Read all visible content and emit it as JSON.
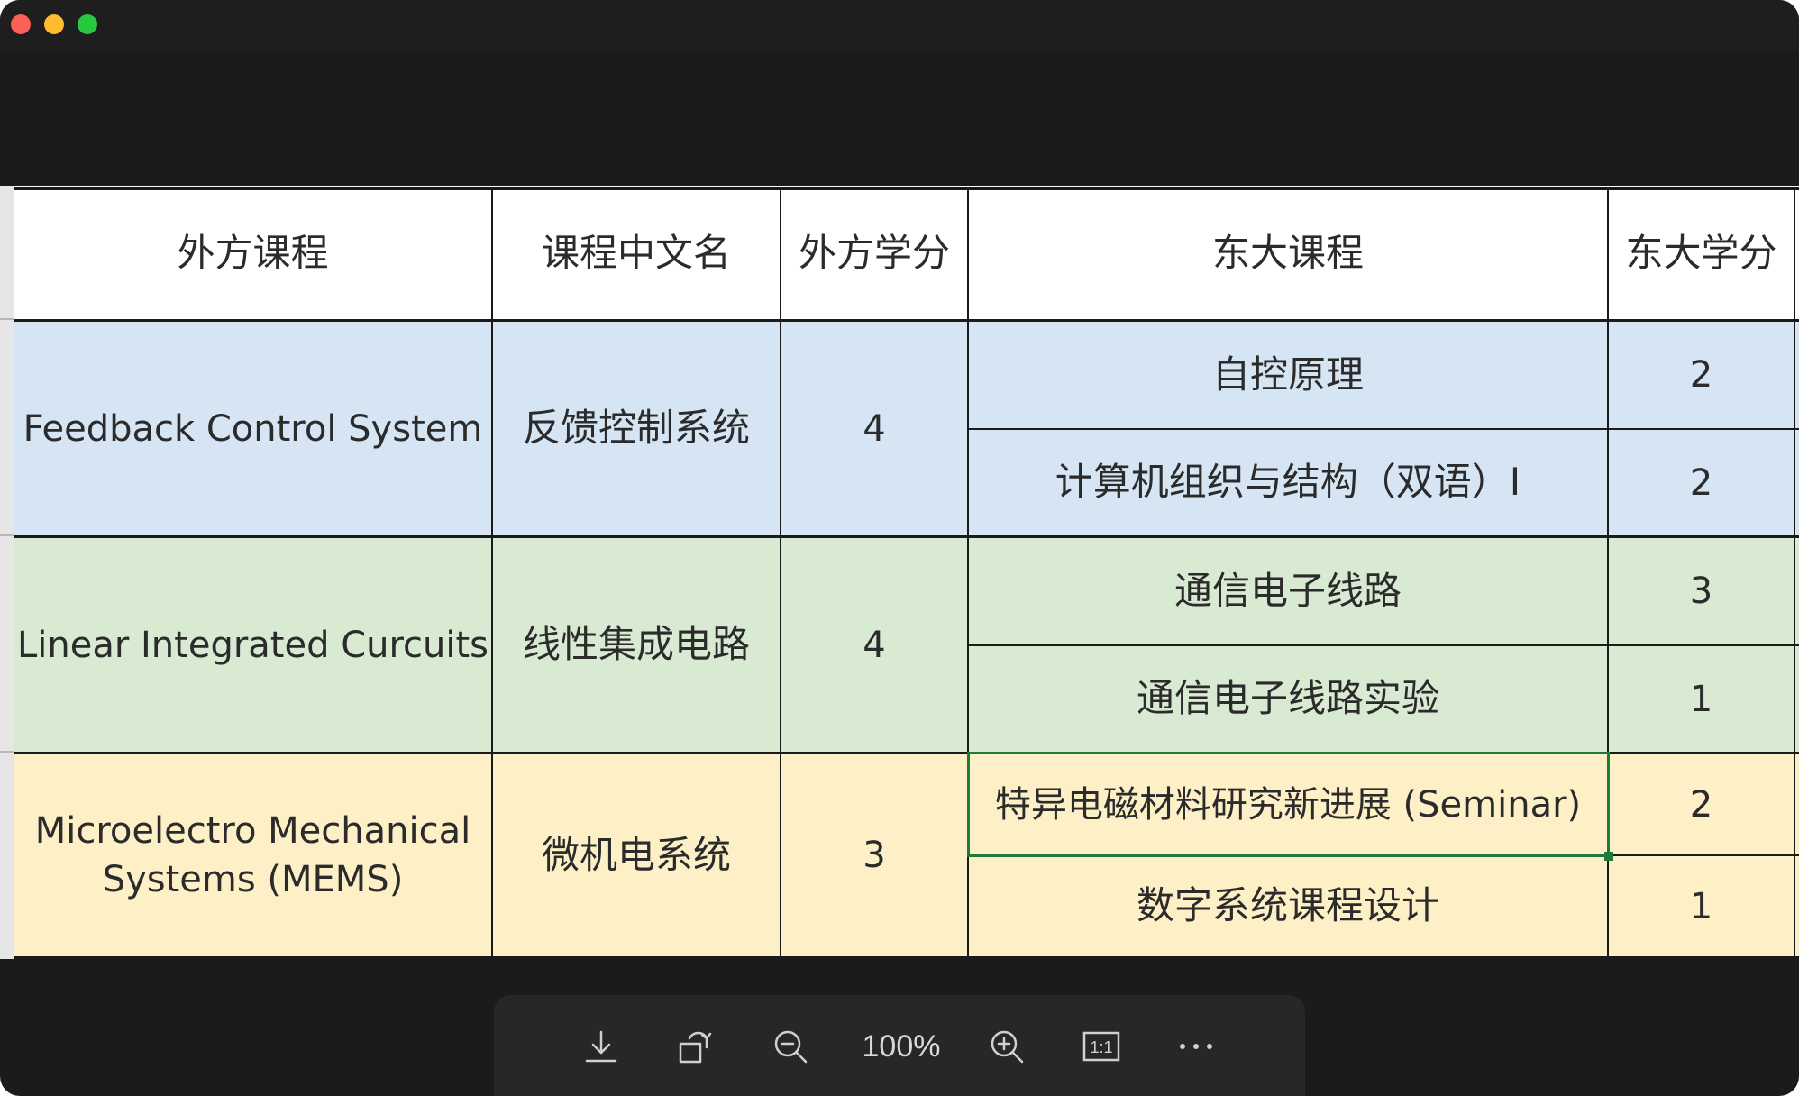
{
  "toolbar": {
    "zoom_label": "100%",
    "buttons": [
      {
        "name": "download-icon"
      },
      {
        "name": "rotate-icon"
      },
      {
        "name": "zoom-out-icon"
      },
      {
        "name": "zoom-in-icon"
      },
      {
        "name": "actual-size-icon",
        "label": "1:1"
      },
      {
        "name": "more-icon"
      }
    ]
  },
  "table": {
    "headers": [
      "外方课程",
      "课程中文名",
      "外方学分",
      "东大课程",
      "东大学分"
    ],
    "groups": [
      {
        "foreign_course": "Feedback Control System",
        "chinese_name": "反馈控制系统",
        "foreign_credits": "4",
        "color": "#d5e5f4",
        "seu_courses": [
          {
            "name": "自控原理",
            "credits": "2"
          },
          {
            "name": "计算机组织与结构（双语）I",
            "credits": "2"
          }
        ]
      },
      {
        "foreign_course": "Linear Integrated Curcuits",
        "chinese_name": "线性集成电路",
        "foreign_credits": "4",
        "color": "#d9ead3",
        "seu_courses": [
          {
            "name": "通信电子线路",
            "credits": "3"
          },
          {
            "name": "通信电子线路实验",
            "credits": "1"
          }
        ]
      },
      {
        "foreign_course": "Microelectro Mechanical Systems (MEMS)",
        "chinese_name": "微机电系统",
        "foreign_credits": "3",
        "color": "#fdf0c7",
        "seu_courses": [
          {
            "name": "特异电磁材料研究新进展 (Seminar)",
            "credits": "2"
          },
          {
            "name": "数字系统课程设计",
            "credits": "1"
          }
        ]
      }
    ]
  }
}
